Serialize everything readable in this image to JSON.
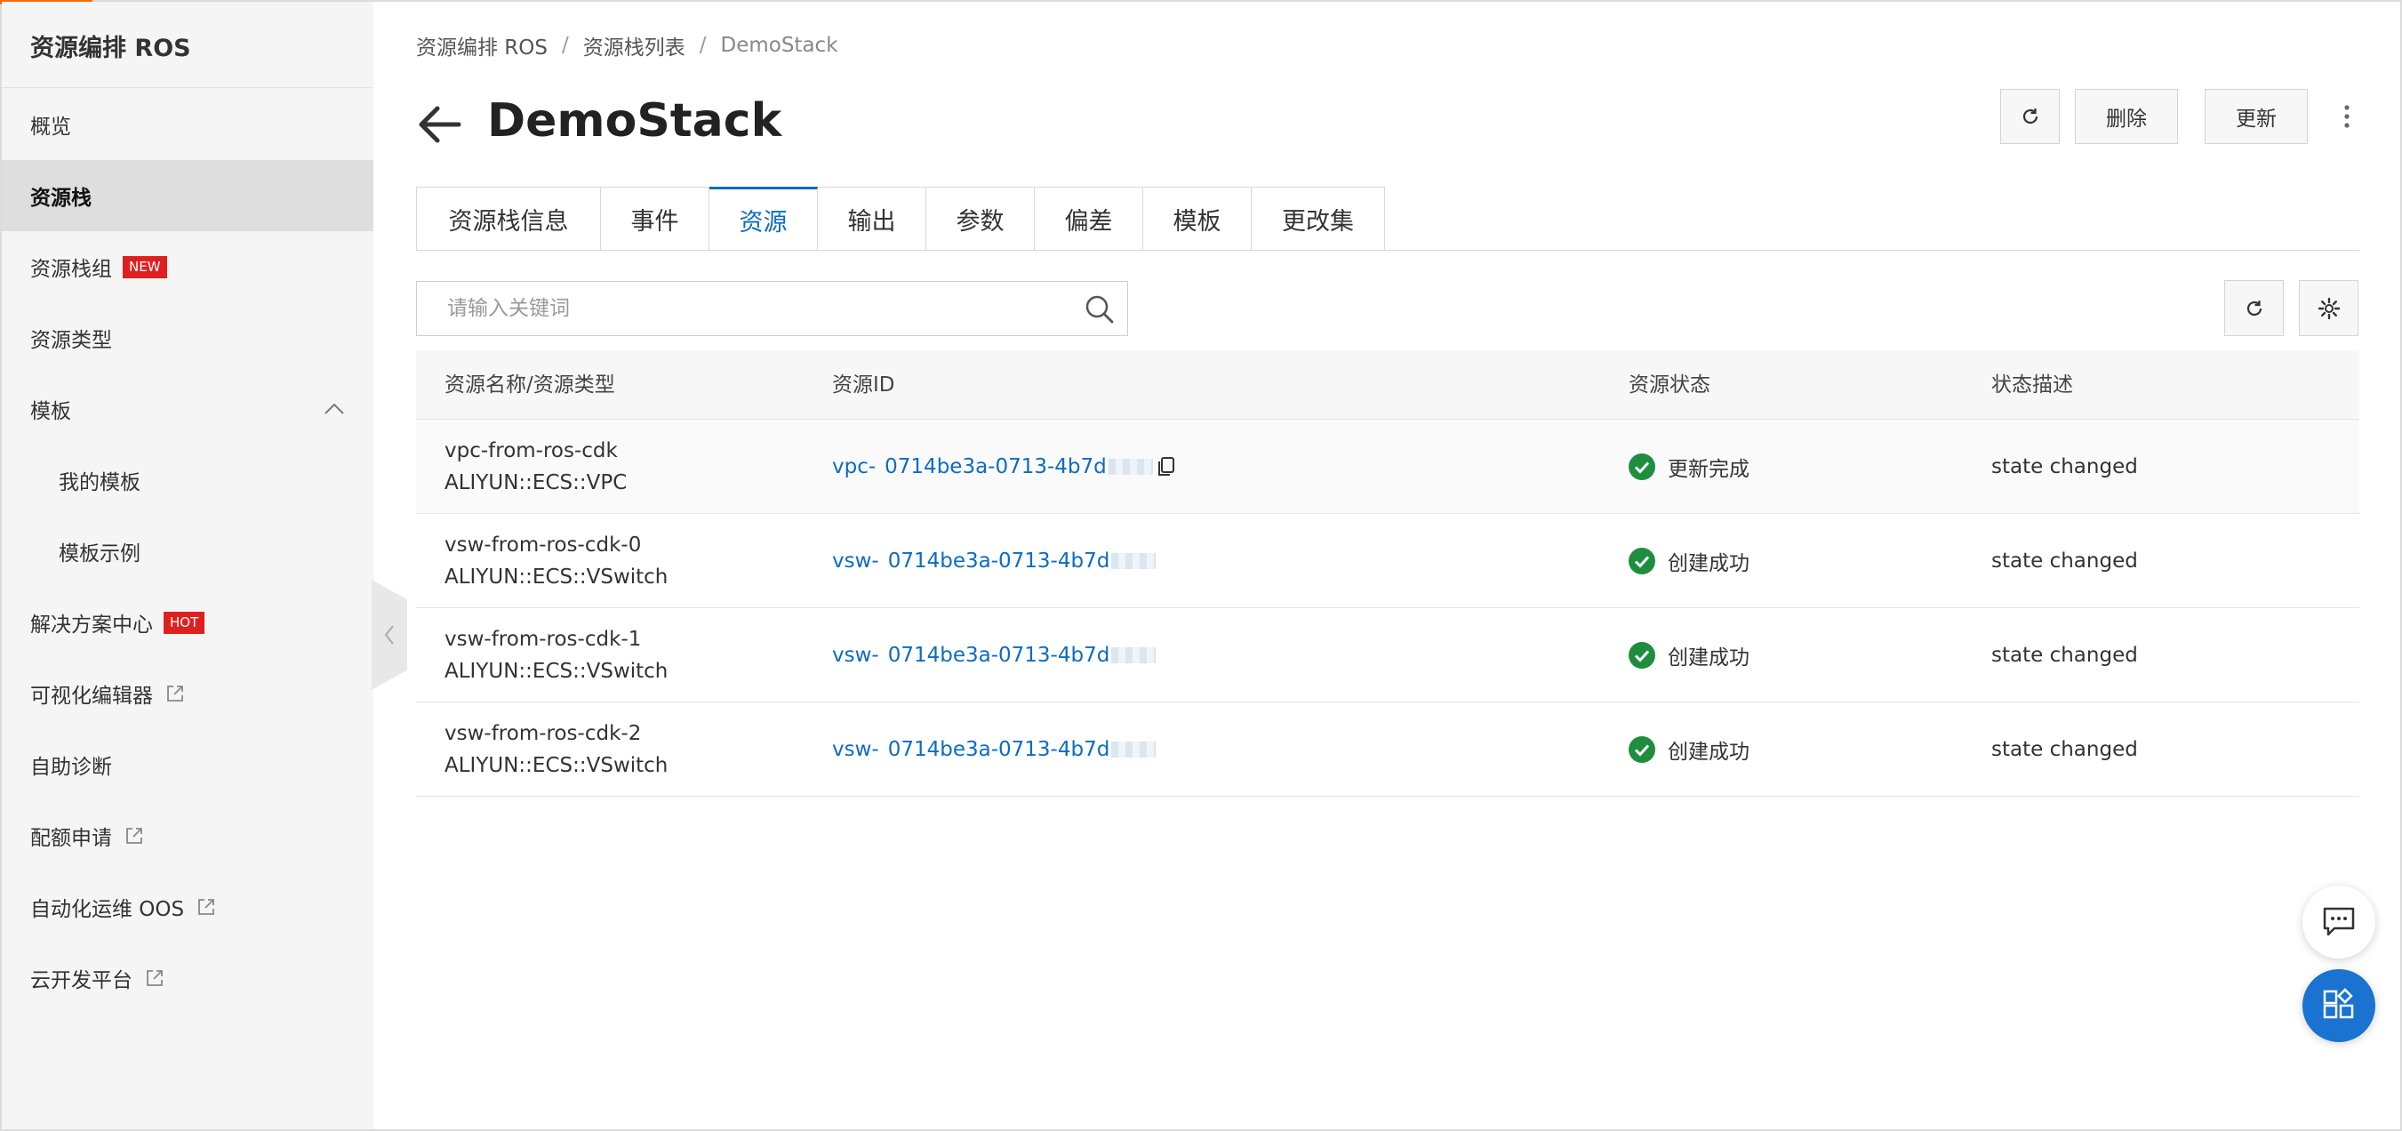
{
  "app": {
    "title": "资源编排 ROS"
  },
  "sidebar": {
    "items": [
      {
        "label": "概览"
      },
      {
        "label": "资源栈",
        "active": true
      },
      {
        "label": "资源栈组",
        "badge": "NEW"
      },
      {
        "label": "资源类型"
      },
      {
        "label": "模板",
        "expanded": true
      },
      {
        "label": "我的模板"
      },
      {
        "label": "模板示例"
      },
      {
        "label": "解决方案中心",
        "badge": "HOT"
      },
      {
        "label": "可视化编辑器",
        "external": true
      },
      {
        "label": "自助诊断"
      },
      {
        "label": "配额申请",
        "external": true
      },
      {
        "label": "自动化运维 OOS",
        "external": true
      },
      {
        "label": "云开发平台",
        "external": true
      }
    ]
  },
  "breadcrumb": [
    "资源编排 ROS",
    "资源栈列表",
    "DemoStack"
  ],
  "page": {
    "title": "DemoStack",
    "actions": {
      "delete": "删除",
      "update": "更新"
    }
  },
  "tabs": [
    {
      "label": "资源栈信息"
    },
    {
      "label": "事件"
    },
    {
      "label": "资源",
      "active": true
    },
    {
      "label": "输出"
    },
    {
      "label": "参数"
    },
    {
      "label": "偏差"
    },
    {
      "label": "模板"
    },
    {
      "label": "更改集"
    }
  ],
  "search": {
    "placeholder": "请输入关键词",
    "value": ""
  },
  "table": {
    "headers": [
      "资源名称/资源类型",
      "资源ID",
      "资源状态",
      "状态描述"
    ],
    "rows": [
      {
        "name": "vpc-from-ros-cdk",
        "type": "ALIYUN::ECS::VPC",
        "id_prefix": "vpc-",
        "id": "0714be3a-0713-4b7d",
        "status": "更新完成",
        "desc": "state changed"
      },
      {
        "name": "vsw-from-ros-cdk-0",
        "type": "ALIYUN::ECS::VSwitch",
        "id_prefix": "vsw-",
        "id": "0714be3a-0713-4b7d",
        "status": "创建成功",
        "desc": "state changed"
      },
      {
        "name": "vsw-from-ros-cdk-1",
        "type": "ALIYUN::ECS::VSwitch",
        "id_prefix": "vsw-",
        "id": "0714be3a-0713-4b7d",
        "status": "创建成功",
        "desc": "state changed"
      },
      {
        "name": "vsw-from-ros-cdk-2",
        "type": "ALIYUN::ECS::VSwitch",
        "id_prefix": "vsw-",
        "id": "0714be3a-0713-4b7d",
        "status": "创建成功",
        "desc": "state changed"
      }
    ]
  },
  "colors": {
    "accent": "#0b6cc4",
    "success": "#1e8e3e",
    "brand": "#ff6a00",
    "badge": "#e02020"
  },
  "icons": [
    "refresh-icon",
    "more-vertical-icon",
    "search-icon",
    "gear-icon",
    "copy-icon",
    "check-circle-icon",
    "external-link-icon",
    "chevron-up-icon",
    "chevron-left-icon",
    "chat-icon",
    "apps-icon",
    "arrow-left-icon"
  ]
}
